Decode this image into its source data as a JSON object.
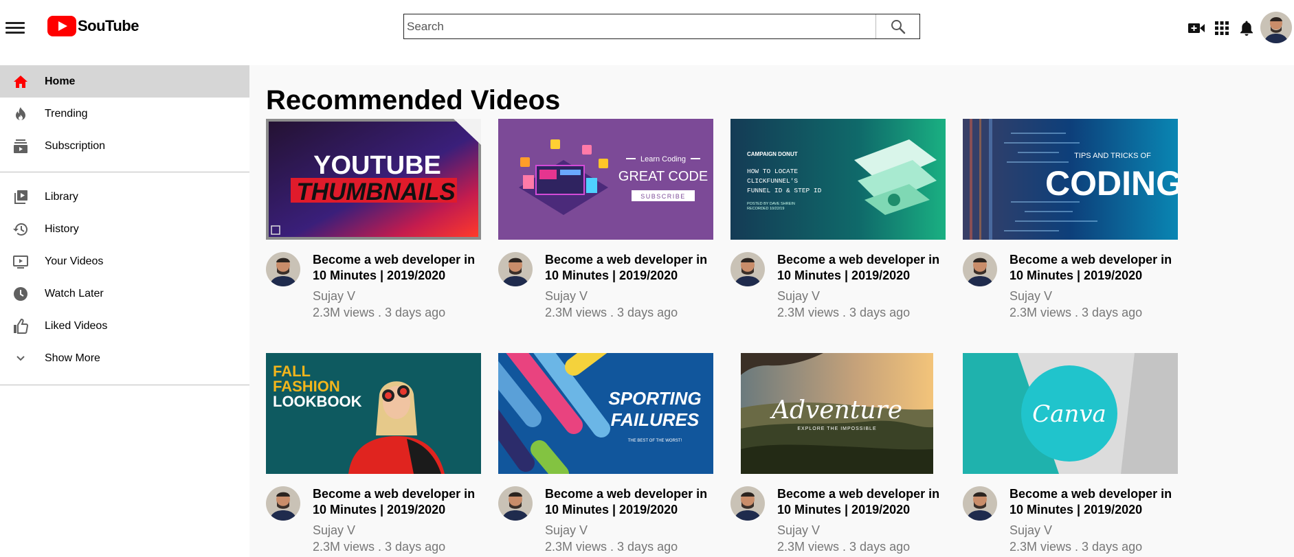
{
  "header": {
    "logo_text": "SouTube",
    "search_placeholder": "Search"
  },
  "sidebar": {
    "items": [
      {
        "label": "Home",
        "icon": "home-icon",
        "active": true
      },
      {
        "label": "Trending",
        "icon": "flame-icon"
      },
      {
        "label": "Subscription",
        "icon": "subscriptions-icon"
      },
      {
        "label": "Library",
        "icon": "library-icon"
      },
      {
        "label": "History",
        "icon": "history-icon"
      },
      {
        "label": "Your Videos",
        "icon": "your-videos-icon"
      },
      {
        "label": "Watch Later",
        "icon": "clock-icon"
      },
      {
        "label": "Liked Videos",
        "icon": "thumbs-up-icon"
      },
      {
        "label": "Show More",
        "icon": "chevron-down-icon"
      }
    ]
  },
  "main": {
    "title": "Recommended Videos",
    "videos": [
      {
        "thumb_lines": [
          "YOUTUBE",
          "THUMBNAILS"
        ],
        "title": "Become a web developer in 10 Minutes | 2019/2020",
        "channel": "Sujay V",
        "stats": "2.3M views . 3 days ago"
      },
      {
        "thumb_lines": [
          "Learn Coding",
          "GREAT CODE",
          "SUBSCRIBE"
        ],
        "title": "Become a web developer in 10 Minutes | 2019/2020",
        "channel": "Sujay V",
        "stats": "2.3M views . 3 days ago"
      },
      {
        "thumb_lines": [
          "CAMPAIGN DONUT",
          "HOW TO LOCATE",
          "CLICKFUNNEL'S",
          "FUNNEL ID & STEP ID",
          "POSTED BY DAVE SHREIN",
          "RECORDED 10/22/19"
        ],
        "title": "Become a web developer in 10 Minutes | 2019/2020",
        "channel": "Sujay V",
        "stats": "2.3M views . 3 days ago"
      },
      {
        "thumb_lines": [
          "TIPS AND TRICKS OF",
          "CODING"
        ],
        "title": "Become a web developer in 10 Minutes | 2019/2020",
        "channel": "Sujay V",
        "stats": "2.3M views . 3 days ago"
      },
      {
        "thumb_lines": [
          "FALL",
          "FASHION",
          "LOOKBOOK"
        ],
        "title": "Become a web developer in 10 Minutes | 2019/2020",
        "channel": "Sujay V",
        "stats": "2.3M views . 3 days ago"
      },
      {
        "thumb_lines": [
          "SPORTING",
          "FAILURES",
          "THE BEST OF THE WORST!"
        ],
        "title": "Become a web developer in 10 Minutes | 2019/2020",
        "channel": "Sujay V",
        "stats": "2.3M views . 3 days ago"
      },
      {
        "thumb_lines": [
          "Adventure",
          "EXPLORE THE IMPOSSIBLE"
        ],
        "title": "Become a web developer in 10 Minutes | 2019/2020",
        "channel": "Sujay V",
        "stats": "2.3M views . 3 days ago"
      },
      {
        "thumb_lines": [
          "Canva"
        ],
        "title": "Become a web developer in 10 Minutes | 2019/2020",
        "channel": "Sujay V",
        "stats": "2.3M views . 3 days ago"
      }
    ]
  },
  "colors": {
    "brand_red": "#ff0000",
    "active_bg": "#d6d6d6",
    "main_bg": "#f9f9f9",
    "meta_gray": "#777777"
  }
}
